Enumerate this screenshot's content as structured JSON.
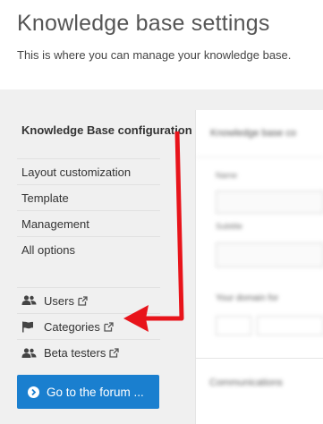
{
  "header": {
    "title": "Knowledge base settings",
    "subtitle": "This is where you can manage your knowledge base."
  },
  "sidebar": {
    "items": [
      {
        "label": "Knowledge Base configuration",
        "active": true
      },
      {
        "label": "Layout customization"
      },
      {
        "label": "Template"
      },
      {
        "label": "Management"
      },
      {
        "label": "All options"
      }
    ],
    "links": [
      {
        "label": "Users",
        "icon": "users-icon"
      },
      {
        "label": "Categories",
        "icon": "flag-icon"
      },
      {
        "label": "Beta testers",
        "icon": "users-icon"
      }
    ]
  },
  "forum_button": {
    "label": "Go to the forum ...",
    "icon": "chevron-right-circle-icon"
  },
  "colors": {
    "primary": "#1a7fcf",
    "annotation": "#e8141b",
    "background": "#f0f0f0"
  }
}
